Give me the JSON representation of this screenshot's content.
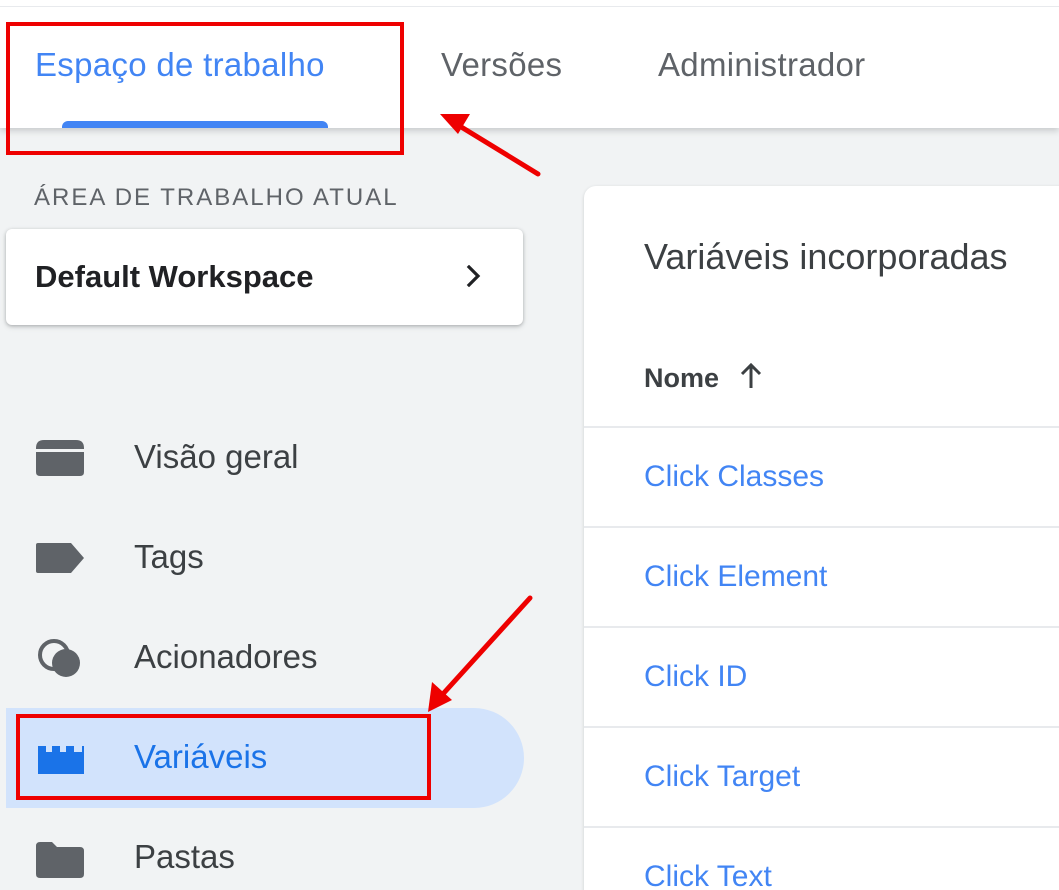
{
  "tabs": [
    {
      "label": "Espaço de trabalho",
      "active": true
    },
    {
      "label": "Versões",
      "active": false
    },
    {
      "label": "Administrador",
      "active": false
    }
  ],
  "workspace": {
    "section_label": "ÁREA DE TRABALHO ATUAL",
    "name": "Default Workspace"
  },
  "nav": [
    {
      "label": "Visão geral",
      "icon": "overview-icon",
      "active": false
    },
    {
      "label": "Tags",
      "icon": "tag-icon",
      "active": false
    },
    {
      "label": "Acionadores",
      "icon": "triggers-icon",
      "active": false
    },
    {
      "label": "Variáveis",
      "icon": "variables-icon",
      "active": true
    },
    {
      "label": "Pastas",
      "icon": "folder-icon",
      "active": false
    }
  ],
  "main": {
    "title": "Variáveis incorporadas",
    "column_header": "Nome",
    "rows": [
      "Click Classes",
      "Click Element",
      "Click ID",
      "Click Target",
      "Click Text"
    ]
  },
  "colors": {
    "accent": "#4285f4",
    "active_nav_bg": "#d2e3fc",
    "annotation": "#ee0000"
  }
}
